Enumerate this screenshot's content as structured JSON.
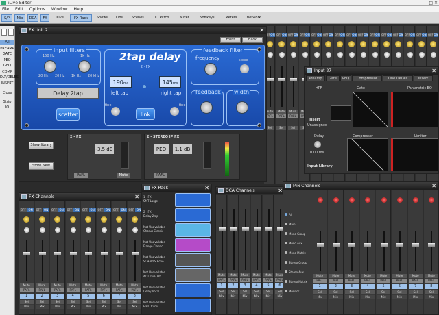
{
  "app": {
    "title": "iLive Editor"
  },
  "menu": [
    "File",
    "Edit",
    "Options",
    "Window",
    "Help"
  ],
  "toolbar": [
    "S/P",
    "Mix",
    "DCA",
    "FX",
    "iLive",
    "FX Rack",
    "Shows",
    "Libs",
    "Scenes",
    "IO Patch",
    "Mixer",
    "Softkeys",
    "Meters",
    "Network"
  ],
  "sidebar": [
    "All",
    "PREAMP",
    "GATE",
    "PEQ",
    "GEQ",
    "COMP",
    "DLY/DELES",
    "INSERT",
    "Close",
    "Strip",
    "IO"
  ],
  "fx_unit": {
    "title": "FX Unit 2",
    "front_btn": "Front",
    "back_btn": "Back",
    "input_filters": "input filters",
    "hpf_range": [
      "20 Hz",
      "20 Hz"
    ],
    "hpf_knob": "150 Hz",
    "lpf_knob": "1k Hz",
    "lpf_range": [
      "1k Hz",
      "20 kHz"
    ],
    "preset_name": "Delay 2tap",
    "scatter": "scatter",
    "brand": "2tap delay",
    "fx_slot": "2 · FX",
    "left_ms": "190",
    "right_ms": "145",
    "ms_unit": "ms",
    "left_tap": "left tap",
    "right_tap": "right tap",
    "link": "link",
    "fine": "fine",
    "feedback_filter": "feedback filter",
    "frequency": "frequency",
    "slope": "slope",
    "feedback": "feedback",
    "width": "width",
    "show_library": "Show library",
    "store_new": "Store New",
    "section1": "2 - FX",
    "section2": "2 - STEREO IP FX",
    "db1": "-3.5 dB",
    "peq": "PEQ",
    "db2": "1.1 dB",
    "mute": "Mute",
    "pafl": "PAFL"
  },
  "input_win": {
    "title": "Input 27",
    "tabs": [
      "Preamp",
      "Gate",
      "PEQ",
      "Compressor",
      "Line DeDes",
      "Insert"
    ],
    "sec_hpf": "HPF",
    "sec_gate": "Gate",
    "sec_peq": "Parametric EQ",
    "sec_delay": "Delay",
    "sec_comp": "Compressor",
    "sec_lim": "Limiter",
    "insert": "Insert",
    "unassigned": "Unassigned",
    "delay_val": "0.00 ms",
    "input_library": "Input Library"
  },
  "fx_channels": {
    "title": "FX Channels",
    "nums": [
      "1",
      "2",
      "3",
      "4",
      "5",
      "6",
      "7",
      "8"
    ]
  },
  "fx_rack": {
    "title": "FX Rack",
    "slots": [
      {
        "label": "1 - FX\nSMT Large"
      },
      {
        "label": "2 - FX\nDelay 2tap"
      },
      {
        "label": "Not Unavailable\nChorus Classic"
      },
      {
        "label": "Not Unavailable\nFlange Classic"
      },
      {
        "label": "Not Unavailable\nSCHARTS Echo"
      },
      {
        "label": "Not Unavailable\nADT Dual Pit"
      },
      {
        "label": "Not Unavailable\nDelay Vocal"
      },
      {
        "label": "Not Unavailable\nHall Drums"
      }
    ]
  },
  "dca": {
    "title": "DCA Channels",
    "nums": [
      "1",
      "2",
      "3",
      "4",
      "5",
      "6"
    ]
  },
  "mix": {
    "title": "Mix Channels",
    "options": [
      "All",
      "Main",
      "Mono Group",
      "Mono Aux",
      "Mono Matrix",
      "Stereo Group",
      "Stereo Aux",
      "Stereo Matrix",
      "Monitor"
    ],
    "nums": [
      "1",
      "2",
      "3",
      "4",
      "5",
      "6",
      "7",
      "8"
    ]
  },
  "strip": {
    "off": "OFF",
    "on": "ON",
    "mute": "Mute",
    "pafl": "PAFL",
    "sel": "Sel",
    "mix": "Mix"
  },
  "colors": {
    "bluepanel": "#1f57c2",
    "accent": "#2d86e0",
    "mute_red": "#c8262a"
  }
}
